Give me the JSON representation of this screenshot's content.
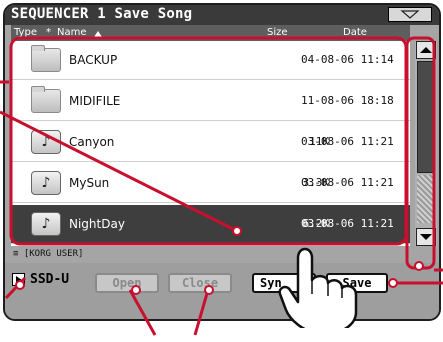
{
  "window": {
    "title": "SEQUENCER 1  Save Song"
  },
  "columns": {
    "type": "Type",
    "star": "*",
    "name": "Name",
    "size": "Size",
    "date": "Date"
  },
  "files": [
    {
      "icon": "folder-icon",
      "name": "BACKUP",
      "size": "",
      "date": "04-08-06 11:14"
    },
    {
      "icon": "folder-icon",
      "name": "MIDIFILE",
      "size": "",
      "date": "11-08-06 18:18"
    },
    {
      "icon": "song-file-icon",
      "name": "Canyon",
      "size": "11K",
      "date": "03-08-06 11:21"
    },
    {
      "icon": "song-file-icon",
      "name": "MySun",
      "size": "3.3K",
      "date": "03-08-06 11:21"
    },
    {
      "icon": "song-file-icon",
      "name": "NightDay",
      "size": "6.2K",
      "date": "03-08-06 11:21"
    }
  ],
  "selected_file": "NightDay",
  "path": "≡ [KORG USER]",
  "device": {
    "label": "SSD-U"
  },
  "buttons": {
    "open": "Open",
    "close": "Close",
    "sync": "Syn",
    "save": "Save"
  },
  "song_glyph": "♪",
  "colors": {
    "callout": "#c8102e",
    "selected_row": "#3e3e3e",
    "title_bar": "#3a3a3a"
  }
}
